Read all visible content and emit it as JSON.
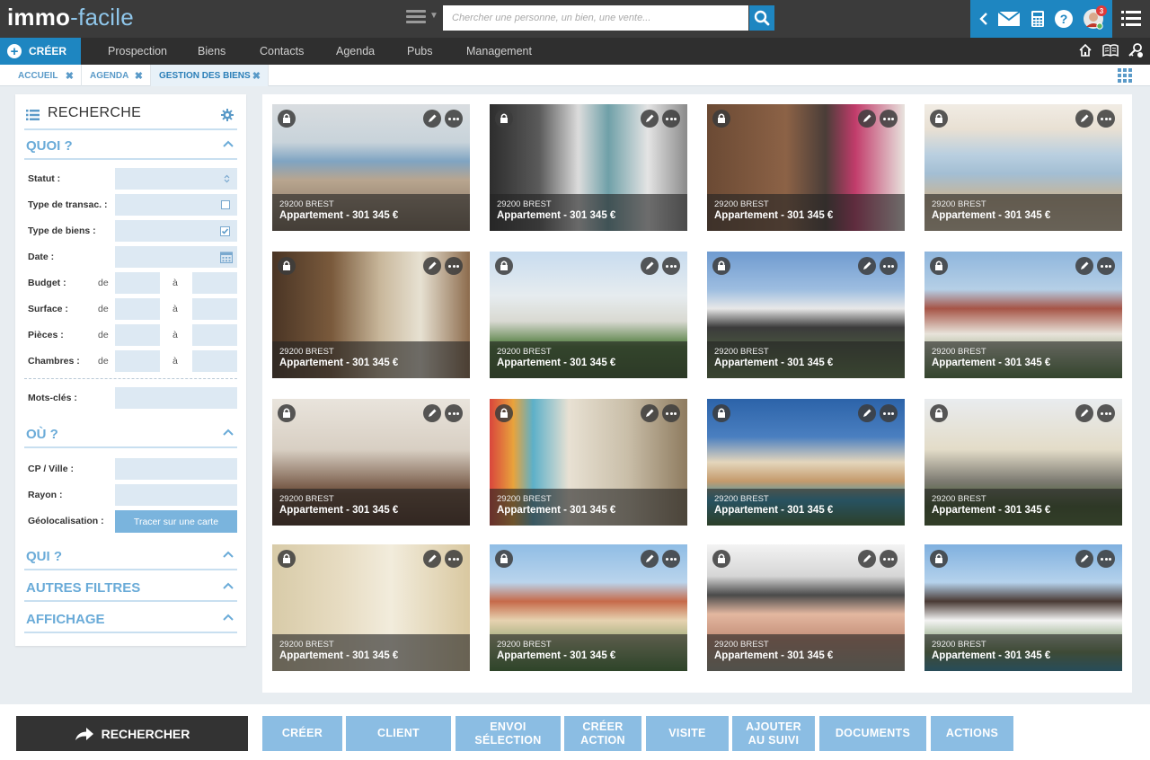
{
  "app": {
    "logo_part1": "immo",
    "logo_part2": "-facile",
    "notification_count": "3"
  },
  "search": {
    "placeholder": "Chercher une personne, un bien, une vente..."
  },
  "nav": {
    "create_label": "CRÉER",
    "items": [
      "Prospection",
      "Biens",
      "Contacts",
      "Agenda",
      "Pubs",
      "Management"
    ]
  },
  "tabs": [
    {
      "label": "ACCUEIL",
      "active": false
    },
    {
      "label": "AGENDA",
      "active": false
    },
    {
      "label": "GESTION DES BIENS",
      "active": true
    }
  ],
  "panel": {
    "title": "RECHERCHE",
    "sections": {
      "quoi": "QUOI ?",
      "ou": "OÙ ?",
      "qui": "QUI ?",
      "autres": "AUTRES FILTRES",
      "affichage": "AFFICHAGE"
    },
    "fields": {
      "statut": "Statut :",
      "type_transac": "Type de transac. :",
      "type_biens": "Type de biens :",
      "date": "Date :",
      "budget": "Budget :",
      "surface": "Surface :",
      "pieces": "Pièces :",
      "chambres": "Chambres :",
      "mots_cles": "Mots-clés :",
      "cp_ville": "CP / Ville :",
      "rayon": "Rayon :",
      "geoloc": "Géolocalisation :"
    },
    "de": "de",
    "a": "à",
    "map_button": "Tracer sur une carte",
    "type_transac_checked": false,
    "type_biens_checked": true
  },
  "listings": [
    {
      "location": "29200 BREST",
      "title": "Appartement - 301 345 €",
      "scene": "living-sea"
    },
    {
      "location": "29200 BREST",
      "title": "Appartement - 301 345 €",
      "scene": "bathroom"
    },
    {
      "location": "29200 BREST",
      "title": "Appartement - 301 345 €",
      "scene": "wood-living"
    },
    {
      "location": "29200 BREST",
      "title": "Appartement - 301 345 €",
      "scene": "window-sea"
    },
    {
      "location": "29200 BREST",
      "title": "Appartement - 301 345 €",
      "scene": "library"
    },
    {
      "location": "29200 BREST",
      "title": "Appartement - 301 345 €",
      "scene": "white-house"
    },
    {
      "location": "29200 BREST",
      "title": "Appartement - 301 345 €",
      "scene": "modern-house"
    },
    {
      "location": "29200 BREST",
      "title": "Appartement - 301 345 €",
      "scene": "red-roof-house"
    },
    {
      "location": "29200 BREST",
      "title": "Appartement - 301 345 €",
      "scene": "dining-room"
    },
    {
      "location": "29200 BREST",
      "title": "Appartement - 301 345 €",
      "scene": "colorful-wall"
    },
    {
      "location": "29200 BREST",
      "title": "Appartement - 301 345 €",
      "scene": "villa-pool"
    },
    {
      "location": "29200 BREST",
      "title": "Appartement - 301 345 €",
      "scene": "cream-house"
    },
    {
      "location": "29200 BREST",
      "title": "Appartement - 301 345 €",
      "scene": "bright-living"
    },
    {
      "location": "29200 BREST",
      "title": "Appartement - 301 345 €",
      "scene": "provence-villa"
    },
    {
      "location": "29200 BREST",
      "title": "Appartement - 301 345 €",
      "scene": "pink-house"
    },
    {
      "location": "29200 BREST",
      "title": "Appartement - 301 345 €",
      "scene": "brown-roof-house"
    }
  ],
  "actions": {
    "search": "RECHERCHER",
    "buttons": [
      {
        "line1": "CRÉER",
        "line2": ""
      },
      {
        "line1": "CLIENT",
        "line2": ""
      },
      {
        "line1": "ENVOI",
        "line2": "SÉLECTION"
      },
      {
        "line1": "CRÉER",
        "line2": "ACTION"
      },
      {
        "line1": "VISITE",
        "line2": ""
      },
      {
        "line1": "AJOUTER",
        "line2": "AU SUIVI"
      },
      {
        "line1": "DOCUMENTS",
        "line2": ""
      },
      {
        "line1": "ACTIONS",
        "line2": ""
      }
    ]
  },
  "colors": {
    "accent": "#1e86c1",
    "light_accent": "#8bbde3",
    "dark_bar": "#3b3b3b"
  }
}
